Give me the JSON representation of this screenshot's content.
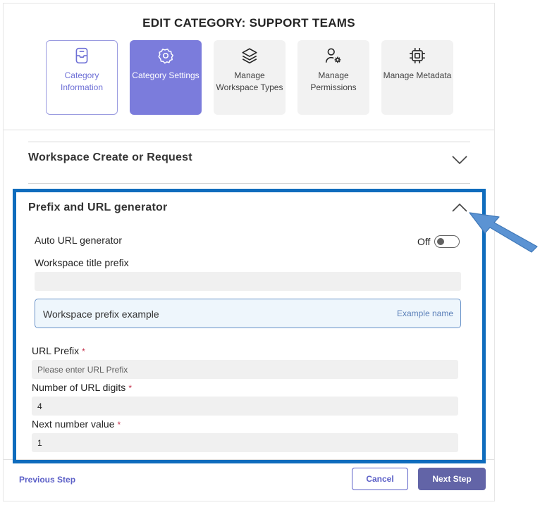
{
  "dialog": {
    "title": "EDIT CATEGORY: SUPPORT TEAMS"
  },
  "steps": [
    {
      "label": "Category Information",
      "icon": "inbox-icon",
      "state": "visited"
    },
    {
      "label": "Category Settings",
      "icon": "settings-icon",
      "state": "active"
    },
    {
      "label": "Manage Workspace Types",
      "icon": "layers-icon",
      "state": "default"
    },
    {
      "label": "Manage Permissions",
      "icon": "person-gear-icon",
      "state": "default"
    },
    {
      "label": "Manage Metadata",
      "icon": "chip-icon",
      "state": "default"
    }
  ],
  "sections": {
    "workspace_create": {
      "title": "Workspace Create or Request",
      "expanded": false
    },
    "prefix_url": {
      "title": "Prefix and URL generator",
      "expanded": true,
      "auto_url": {
        "label": "Auto URL generator",
        "state_label": "Off",
        "on": false
      },
      "title_prefix": {
        "label": "Workspace title prefix",
        "value": ""
      },
      "example": {
        "label": "Workspace prefix example",
        "value": "Example name"
      },
      "url_prefix": {
        "label": "URL Prefix",
        "required": "*",
        "placeholder": "Please enter URL Prefix",
        "value": ""
      },
      "url_digits": {
        "label": "Number of URL digits",
        "required": "*",
        "value": "4"
      },
      "next_number": {
        "label": "Next number value",
        "required": "*",
        "value": "1"
      }
    }
  },
  "footer": {
    "previous_label": "Previous Step",
    "cancel_label": "Cancel",
    "next_label": "Next Step"
  },
  "colors": {
    "accent": "#6264a7",
    "active_step": "#7b7cdc",
    "highlight": "#0f6cbd",
    "arrow": "#5b93d3"
  }
}
